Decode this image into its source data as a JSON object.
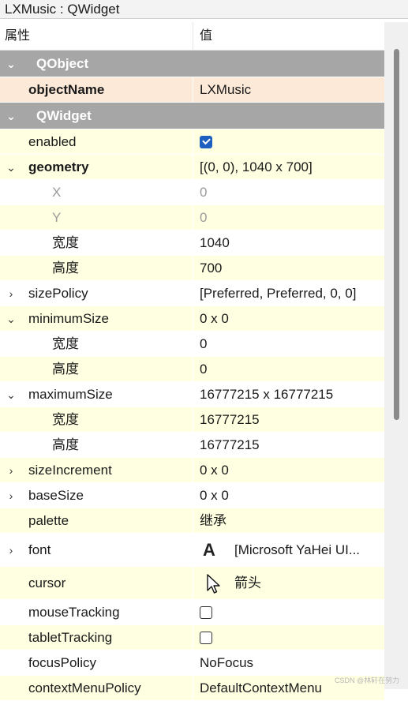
{
  "window": {
    "title": "LXMusic : QWidget"
  },
  "header": {
    "property_col": "属性",
    "value_col": "值"
  },
  "groups": {
    "qobject": "QObject",
    "qwidget": "QWidget"
  },
  "props": {
    "objectName": {
      "name": "objectName",
      "value": "LXMusic"
    },
    "enabled": {
      "name": "enabled",
      "checked": true
    },
    "geometry": {
      "name": "geometry",
      "value": "[(0, 0), 1040 x 700]",
      "x_label": "X",
      "x_value": "0",
      "y_label": "Y",
      "y_value": "0",
      "w_label": "宽度",
      "w_value": "1040",
      "h_label": "高度",
      "h_value": "700"
    },
    "sizePolicy": {
      "name": "sizePolicy",
      "value": "[Preferred, Preferred, 0, 0]"
    },
    "minimumSize": {
      "name": "minimumSize",
      "value": "0 x 0",
      "w_label": "宽度",
      "w_value": "0",
      "h_label": "高度",
      "h_value": "0"
    },
    "maximumSize": {
      "name": "maximumSize",
      "value": "16777215 x 16777215",
      "w_label": "宽度",
      "w_value": "16777215",
      "h_label": "高度",
      "h_value": "16777215"
    },
    "sizeIncrement": {
      "name": "sizeIncrement",
      "value": "0 x 0"
    },
    "baseSize": {
      "name": "baseSize",
      "value": "0 x 0"
    },
    "palette": {
      "name": "palette",
      "value": "继承"
    },
    "font": {
      "name": "font",
      "icon_glyph": "A",
      "value": "[Microsoft YaHei UI..."
    },
    "cursor": {
      "name": "cursor",
      "value": "箭头"
    },
    "mouseTracking": {
      "name": "mouseTracking",
      "checked": false
    },
    "tabletTracking": {
      "name": "tabletTracking",
      "checked": false
    },
    "focusPolicy": {
      "name": "focusPolicy",
      "value": "NoFocus"
    },
    "contextMenuPolicy": {
      "name": "contextMenuPolicy",
      "value": "DefaultContextMenu"
    }
  },
  "watermark": "CSDN @林轩在努力",
  "colors": {
    "group_bg": "#a6a6a6",
    "row_yellow": "#ffffe1",
    "row_selected": "#fde9d8",
    "check_blue": "#1e5fbf"
  }
}
